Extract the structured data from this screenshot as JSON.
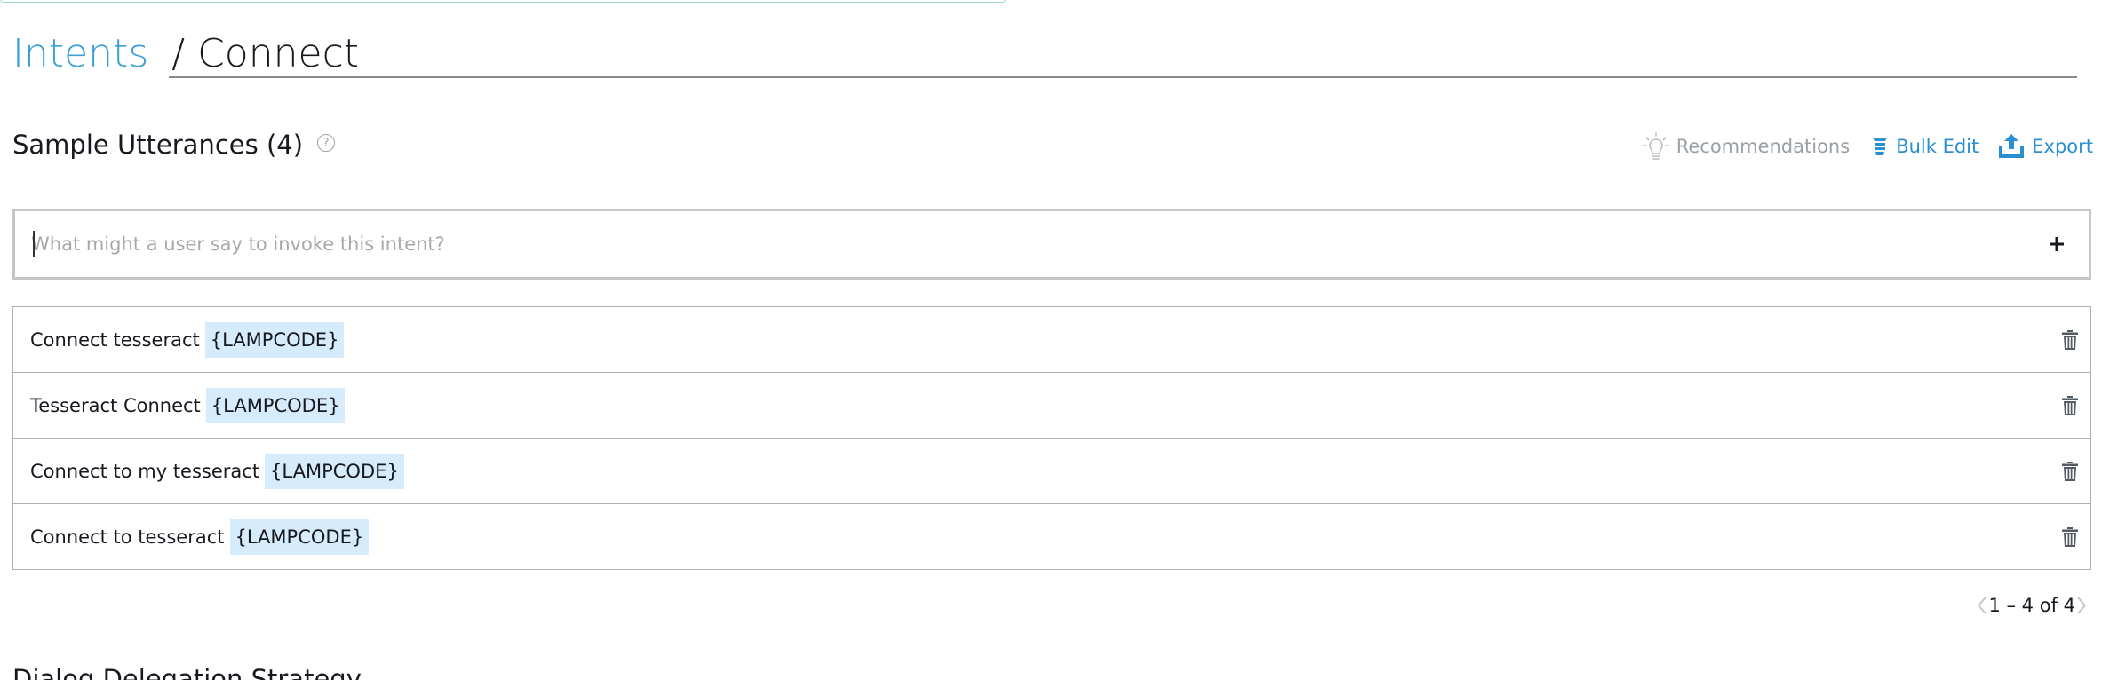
{
  "breadcrumb": {
    "parent": "Intents",
    "separator": "/",
    "current": "Connect"
  },
  "sample_utterances": {
    "title": "Sample Utterances (4)",
    "help": "?",
    "actions": {
      "recommendations": "Recommendations",
      "bulk_edit": "Bulk Edit",
      "export": "Export"
    },
    "input_placeholder": "What might a user say to invoke this intent?",
    "items": [
      {
        "text": "Connect tesseract",
        "slot": "{LAMPCODE}"
      },
      {
        "text": "Tesseract Connect",
        "slot": "{LAMPCODE}"
      },
      {
        "text": "Connect to my tesseract",
        "slot": "{LAMPCODE}"
      },
      {
        "text": "Connect to tesseract",
        "slot": "{LAMPCODE}"
      }
    ],
    "pagination": "1 – 4 of 4"
  },
  "next_section": {
    "title": "Dialog Delegation Strategy"
  },
  "colors": {
    "link": "#3aa0d6",
    "action": "#2a8fd0",
    "slot_bg": "#d6ebfb",
    "muted": "#9aa0a6"
  },
  "icons": {
    "help": "question-circle-icon",
    "recommend": "lightbulb-icon",
    "bulk": "bulk-edit-icon",
    "export": "upload-icon",
    "add": "plus-icon",
    "delete": "trash-icon"
  }
}
